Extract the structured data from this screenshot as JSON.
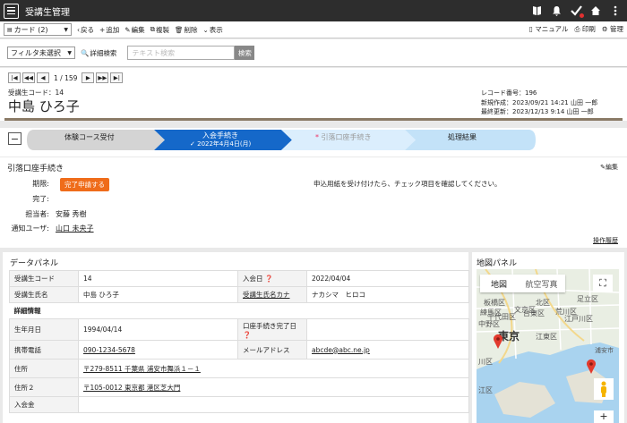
{
  "app": {
    "title": "受講生管理"
  },
  "toolbar": {
    "view_select": "カード (2)",
    "back": "戻る",
    "add": "追加",
    "edit": "編集",
    "copy": "複製",
    "delete": "削除",
    "display": "表示",
    "manual": "マニュアル",
    "print": "印刷",
    "admin": "管理"
  },
  "filter": {
    "select": "フィルタ未選択",
    "detail_search": "詳細検索",
    "placeholder": "テキスト検索",
    "search_button": "検索"
  },
  "record": {
    "pager": "1 / 159",
    "code_label": "受講生コード：",
    "code_value": "14",
    "name": "中島 ひろ子",
    "record_no": "レコード番号：196",
    "created": "新規作成：2023/09/21 14:21 山田 一郎",
    "updated": "最終更新：2023/12/13 9:14 山田 一郎"
  },
  "steps": [
    {
      "label": "体験コース受付"
    },
    {
      "label": "入会手続き",
      "sub": "2022年4月4日(月)"
    },
    {
      "label": "引落口座手続き"
    },
    {
      "label": "処理結果"
    }
  ],
  "process": {
    "title": "引落口座手続き",
    "edit": "編集",
    "deadline_label": "期限:",
    "badge": "完了申請する",
    "done_label": "完了:",
    "owner_label": "担当者:",
    "owner_value": "安藤 秀樹",
    "notify_label": "通知ユーザ:",
    "notify_value": "山口 未央子",
    "message": "申込用紙を受け付けたら、チェック項目を確認してください。",
    "history": "操作履歴"
  },
  "datapanel": {
    "title": "データパネル",
    "code_label": "受講生コード",
    "code_value": "14",
    "join_label": "入会日",
    "join_value": "2022/04/04",
    "name_label": "受講生氏名",
    "name_value": "中島 ひろ子",
    "kana_label": "受講生氏名カナ",
    "kana_value": "ナカシマ　ヒロコ",
    "detail_heading": "詳細情報",
    "birth_label": "生年月日",
    "birth_value": "1994/04/14",
    "account_label": "口座手続き完了日",
    "mobile_label": "携帯電話",
    "mobile_value": "090-1234-5678",
    "mail_label": "メールアドレス",
    "mail_value": "abcde@abc.ne.jp",
    "addr_label": "住所",
    "addr_value": "〒279-8511 千葉県 浦安市舞浜１－１",
    "addr2_label": "住所２",
    "addr2_value": "〒105-0012 東京都 港区芝大門",
    "fee_label": "入会金"
  },
  "mappanel": {
    "title": "地図パネル",
    "tab_map": "地図",
    "tab_sat": "航空写真",
    "labels": [
      "板橋区",
      "北区",
      "足立区",
      "練馬区",
      "文京区",
      "荒川区",
      "中野区",
      "千代田区",
      "台東区",
      "江戸川区",
      "東京",
      "江東区",
      "浦安市",
      "川区",
      "江区"
    ]
  }
}
